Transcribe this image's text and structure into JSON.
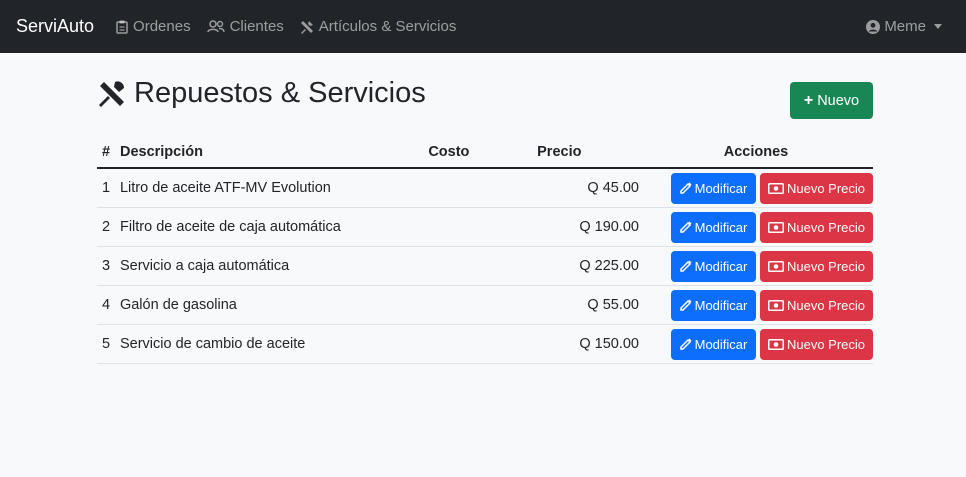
{
  "navbar": {
    "brand": "ServiAuto",
    "links": [
      {
        "label": "Ordenes",
        "icon": "clipboard-icon"
      },
      {
        "label": "Clientes",
        "icon": "users-icon"
      },
      {
        "label": "Artículos & Servicios",
        "icon": "tools-icon"
      }
    ],
    "user": "Meme"
  },
  "page": {
    "title": "Repuestos & Servicios",
    "new_button": "Nuevo"
  },
  "table": {
    "headers": {
      "num": "#",
      "desc": "Descripción",
      "cost": "Costo",
      "price": "Precio",
      "actions": "Acciones"
    },
    "rows": [
      {
        "num": "1",
        "desc": "Litro de aceite ATF-MV Evolution",
        "cost": "",
        "price": "Q 45.00"
      },
      {
        "num": "2",
        "desc": "Filtro de aceite de caja automática",
        "cost": "",
        "price": "Q 190.00"
      },
      {
        "num": "3",
        "desc": "Servicio a caja automática",
        "cost": "",
        "price": "Q 225.00"
      },
      {
        "num": "4",
        "desc": "Galón de gasolina",
        "cost": "",
        "price": "Q 55.00"
      },
      {
        "num": "5",
        "desc": "Servicio de cambio de aceite",
        "cost": "",
        "price": "Q 150.00"
      }
    ],
    "modify_label": "Modificar",
    "new_price_label": "Nuevo Precio"
  },
  "colors": {
    "navbar": "#212529",
    "success": "#198754",
    "primary": "#0d6efd",
    "danger": "#dc3545"
  }
}
